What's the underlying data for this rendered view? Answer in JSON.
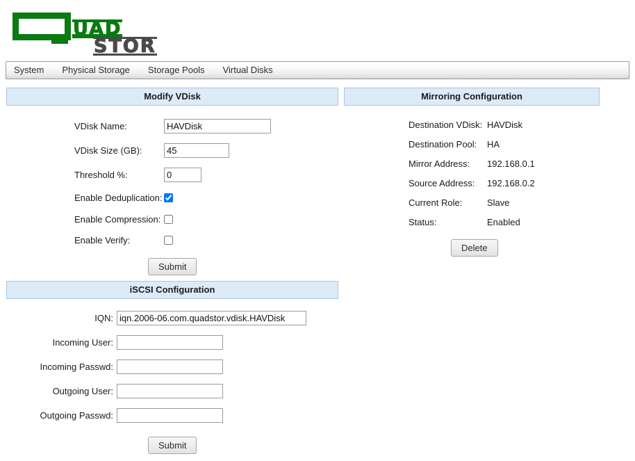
{
  "brand": {
    "logo_q": "Q",
    "logo_word_green": "UAD",
    "logo_word_gray": "STOR",
    "green": "#0a7a12",
    "gray": "#4a4a4a"
  },
  "nav": {
    "items": [
      {
        "label": "System"
      },
      {
        "label": "Physical Storage"
      },
      {
        "label": "Storage Pools"
      },
      {
        "label": "Virtual Disks"
      }
    ]
  },
  "modify_vdisk": {
    "title": "Modify VDisk",
    "fields": {
      "vdisk_name": {
        "label": "VDisk Name:",
        "value": "HAVDisk",
        "placeholder": ""
      },
      "vdisk_size": {
        "label": "VDisk Size (GB):",
        "value": "45",
        "placeholder": ""
      },
      "threshold": {
        "label": "Threshold %:",
        "value": "0",
        "placeholder": ""
      },
      "dedup": {
        "label": "Enable Deduplication:",
        "checked": true
      },
      "compression": {
        "label": "Enable Compression:",
        "checked": false
      },
      "verify": {
        "label": "Enable Verify:",
        "checked": false
      }
    },
    "submit_label": "Submit"
  },
  "mirroring": {
    "title": "Mirroring Configuration",
    "rows": [
      {
        "label": "Destination VDisk:",
        "value": "HAVDisk"
      },
      {
        "label": "Destination Pool:",
        "value": "HA"
      },
      {
        "label": "Mirror Address:",
        "value": "192.168.0.1"
      },
      {
        "label": "Source Address:",
        "value": "192.168.0.2"
      },
      {
        "label": "Current Role:",
        "value": "Slave"
      },
      {
        "label": "Status:",
        "value": "Enabled"
      }
    ],
    "delete_label": "Delete"
  },
  "iscsi": {
    "title": "iSCSI Configuration",
    "fields": {
      "iqn": {
        "label": "IQN:",
        "value": "iqn.2006-06.com.quadstor.vdisk.HAVDisk",
        "placeholder": ""
      },
      "incoming_user": {
        "label": "Incoming User:",
        "value": "",
        "placeholder": ""
      },
      "incoming_passwd": {
        "label": "Incoming Passwd:",
        "value": "",
        "placeholder": ""
      },
      "outgoing_user": {
        "label": "Outgoing User:",
        "value": "",
        "placeholder": ""
      },
      "outgoing_passwd": {
        "label": "Outgoing Passwd:",
        "value": "",
        "placeholder": ""
      }
    },
    "submit_label": "Submit"
  }
}
